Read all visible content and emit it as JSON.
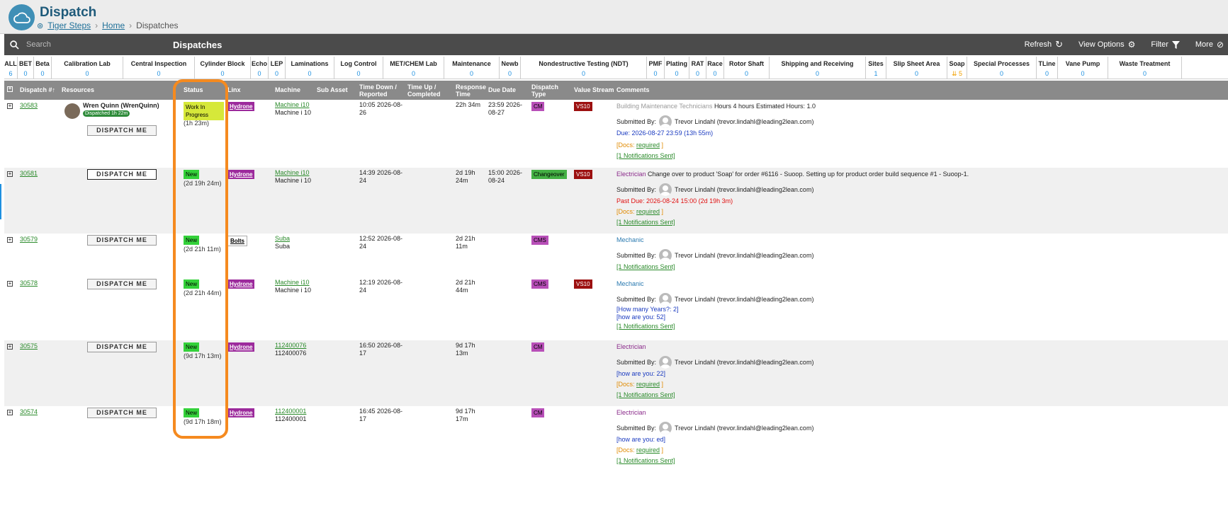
{
  "app": {
    "title": "Dispatch",
    "breadcrumbs": [
      "Tiger Steps",
      "Home",
      "Dispatches"
    ]
  },
  "toolbar": {
    "search_placeholder": "Search",
    "title": "Dispatches",
    "refresh": "Refresh",
    "view_options": "View Options",
    "filter": "Filter",
    "more": "More"
  },
  "filters": [
    {
      "label": "ALL",
      "count": "6"
    },
    {
      "label": "BET",
      "count": "0"
    },
    {
      "label": "Beta",
      "count": "0"
    },
    {
      "label": "Calibration Lab",
      "count": "0"
    },
    {
      "label": "Central Inspection",
      "count": "0"
    },
    {
      "label": "Cylinder Block",
      "count": "0"
    },
    {
      "label": "Echo",
      "count": "0"
    },
    {
      "label": "LEP",
      "count": "0"
    },
    {
      "label": "Laminations",
      "count": "0"
    },
    {
      "label": "Log Control",
      "count": "0"
    },
    {
      "label": "MET/CHEM Lab",
      "count": "0"
    },
    {
      "label": "Maintenance",
      "count": "0"
    },
    {
      "label": "Newb",
      "count": "0"
    },
    {
      "label": "Nondestructive Testing (NDT)",
      "count": "0"
    },
    {
      "label": "PMF",
      "count": "0"
    },
    {
      "label": "Plating",
      "count": "0"
    },
    {
      "label": "RAT",
      "count": "0"
    },
    {
      "label": "Race",
      "count": "0"
    },
    {
      "label": "Rotor Shaft",
      "count": "0"
    },
    {
      "label": "Shipping and Receiving",
      "count": "0"
    },
    {
      "label": "Sites",
      "count": "1"
    },
    {
      "label": "Slip Sheet Area",
      "count": "0"
    },
    {
      "label": "Soap",
      "count": "⇊ 5"
    },
    {
      "label": "Special Processes",
      "count": "0"
    },
    {
      "label": "TLine",
      "count": "0"
    },
    {
      "label": "Vane Pump",
      "count": "0"
    },
    {
      "label": "Waste Treatment",
      "count": "0"
    }
  ],
  "columns": {
    "dispatch": "Dispatch #↑",
    "resources": "Resources",
    "status": "Status",
    "linx": "Linx",
    "machine": "Machine",
    "subasset": "Sub Asset",
    "timedown": "Time Down / Reported",
    "timeup": "Time Up / Completed",
    "response": "Response Time",
    "duedate": "Due Date",
    "dtype": "Dispatch Type",
    "vstream": "Value Stream",
    "comments": "Comments"
  },
  "dispatch_me": "DISPATCH ME",
  "rows": [
    {
      "num": "30583",
      "resource_name": "Wren Quinn (WrenQuinn)",
      "resource_badge": "Dispatched 1h 22m",
      "status": "Work In Progress",
      "status_time": "(1h 23m)",
      "linx": "Hydrone",
      "machine_link": "Machine i10",
      "machine_sub": "Machine i 10",
      "time_down": "10:05 2026-08-26",
      "response": "22h 34m",
      "due": "23:59 2026-08-27",
      "dtype": "CM",
      "vs": "VS10",
      "role": "Building Maintenance Technicians",
      "comment": "Hours 4 hours Estimated Hours: 1.0",
      "submitted": "Submitted By:",
      "submitter": "Trevor Lindahl (trevor.lindahl@leading2lean.com)",
      "due_line": "Due: 2026-08-27 23:59 (13h 55m)",
      "docs_pre": "[Docs: ",
      "docs_req": "required",
      "docs_post": " ]",
      "notif": "[1 Notifications Sent]"
    },
    {
      "num": "30581",
      "status": "New",
      "status_time": "(2d 19h 24m)",
      "linx": "Hydrone",
      "machine_link": "Machine i10",
      "machine_sub": "Machine i 10",
      "time_down": "14:39 2026-08-24",
      "response": "2d 19h 24m",
      "due": "15:00 2026-08-24",
      "dtype": "Changeover",
      "vs": "VS10",
      "role": "Electrician",
      "comment": "Change over to product 'Soap' for order #6116 - Suoop. Setting up for product order build sequence #1 - Suoop-1.",
      "submitted": "Submitted By:",
      "submitter": "Trevor Lindahl (trevor.lindahl@leading2lean.com)",
      "due_line": "Past Due: 2026-08-24 15:00 (2d 19h 3m)",
      "docs_pre": "[Docs: ",
      "docs_req": "required",
      "docs_post": " ]",
      "notif": "[1 Notifications Sent]"
    },
    {
      "num": "30579",
      "status": "New",
      "status_time": "(2d 21h 11m)",
      "linx": "Bolts",
      "machine_link": "Suba",
      "machine_sub": "Suba",
      "time_down": "12:52 2026-08-24",
      "response": "2d 21h 11m",
      "dtype": "CMS",
      "role": "Mechanic",
      "submitted": "Submitted By:",
      "submitter": "Trevor Lindahl (trevor.lindahl@leading2lean.com)",
      "notif": "[1 Notifications Sent]"
    },
    {
      "num": "30578",
      "status": "New",
      "status_time": "(2d 21h 44m)",
      "linx": "Hydrone",
      "machine_link": "Machine i10",
      "machine_sub": "Machine i 10",
      "time_down": "12:19 2026-08-24",
      "response": "2d 21h 44m",
      "dtype": "CMS",
      "vs": "VS10",
      "role": "Mechanic",
      "submitted": "Submitted By:",
      "submitter": "Trevor Lindahl (trevor.lindahl@leading2lean.com)",
      "q1": "[How many Years?: 2]",
      "q2": "[how are you: 52]",
      "notif": "[1 Notifications Sent]"
    },
    {
      "num": "30575",
      "status": "New",
      "status_time": "(9d 17h 13m)",
      "linx": "Hydrone",
      "machine_link": "112400076",
      "machine_sub": "112400076",
      "time_down": "16:50 2026-08-17",
      "response": "9d 17h 13m",
      "dtype": "CM",
      "role": "Electrician",
      "submitted": "Submitted By:",
      "submitter": "Trevor Lindahl (trevor.lindahl@leading2lean.com)",
      "q1": "[how are you: 22]",
      "docs_pre": "[Docs: ",
      "docs_req": "required",
      "docs_post": " ]",
      "notif": "[1 Notifications Sent]"
    },
    {
      "num": "30574",
      "status": "New",
      "status_time": "(9d 17h 18m)",
      "linx": "Hydrone",
      "machine_link": "112400001",
      "machine_sub": "112400001",
      "time_down": "16:45 2026-08-17",
      "response": "9d 17h 17m",
      "dtype": "CM",
      "role": "Electrician",
      "submitted": "Submitted By:",
      "submitter": "Trevor Lindahl (trevor.lindahl@leading2lean.com)",
      "q1": "[how are you: ed]",
      "docs_pre": "[Docs: ",
      "docs_req": "required",
      "docs_post": " ]",
      "notif": "[1 Notifications Sent]"
    }
  ]
}
